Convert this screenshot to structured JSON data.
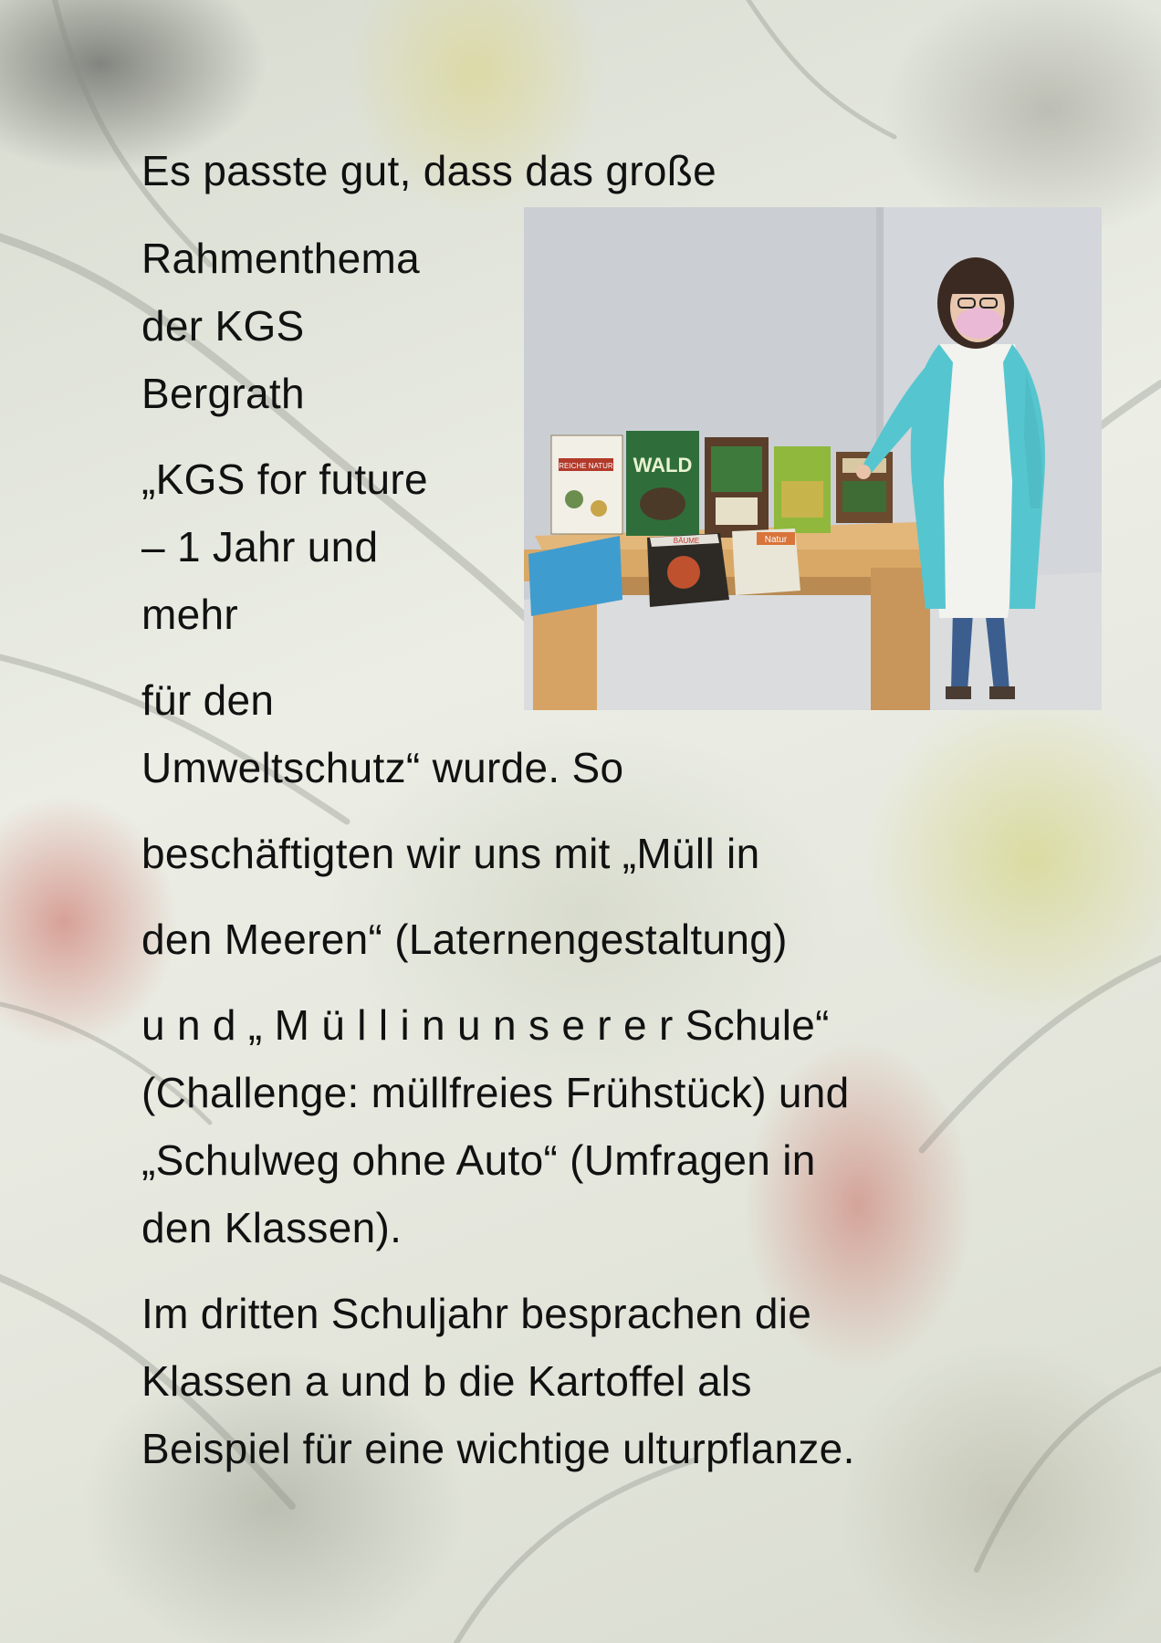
{
  "paragraphs": {
    "p1": "Es  passte  gut,  dass  das  große",
    "p2": "Rahmenthema",
    "p3": "der  KGS",
    "p4": "Bergrath",
    "p5": "„KGS for future",
    "p6": "– 1 Jahr und",
    "p7": "mehr",
    "p8": "für  den",
    "p9": "Umweltschutz“  wurde.  So",
    "p10": "beschäftigten  wir  uns  mit  „Müll  in",
    "p11": "den  Meeren“  (Laternengestaltung)",
    "p12": "u n d  „ M ü l l  i n  u n s e r e r Schule“",
    "p13": "(Challenge:  müllfreies Frühstück)  und",
    "p14": "„Schulweg  ohne Auto“ (Umfragen in",
    "p15": "den Klassen).",
    "p16": "Im dritten Schuljahr besprachen die",
    "p17": "Klassen a und b die Kartoffel als",
    "p18": "Beispiel für eine wichtige  ulturpflanze."
  },
  "photo": {
    "books": [
      "REICHE NATUR",
      "WALD",
      "BÄUME",
      "Natur"
    ]
  }
}
